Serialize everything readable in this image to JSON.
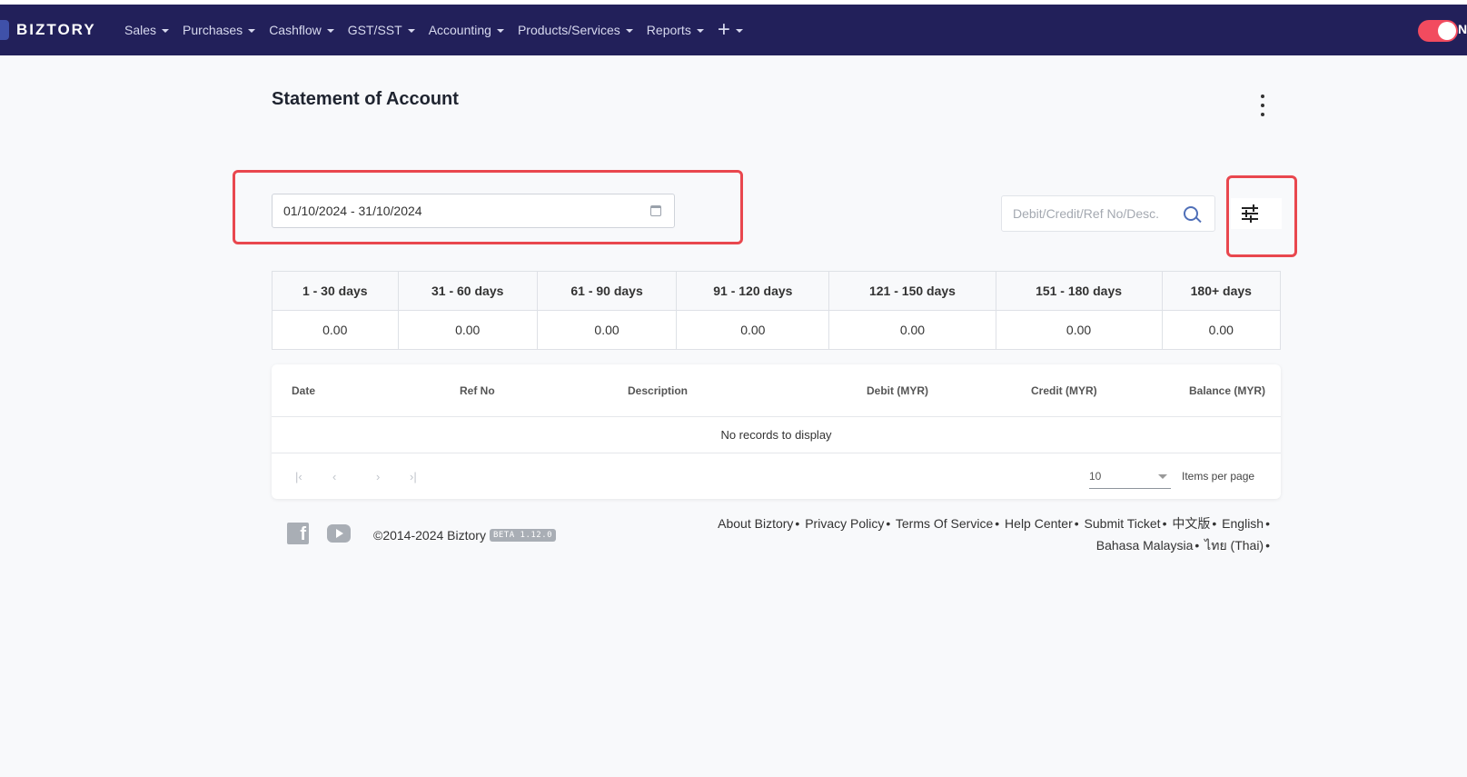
{
  "navbar": {
    "brand": "BIZTORY",
    "menu": [
      {
        "label": "Sales"
      },
      {
        "label": "Purchases"
      },
      {
        "label": "Cashflow"
      },
      {
        "label": "GST/SST"
      },
      {
        "label": "Accounting"
      },
      {
        "label": "Products/Services"
      },
      {
        "label": "Reports"
      }
    ],
    "plus_symbol": "+",
    "toggle_text": "N",
    "toggle_on": true,
    "toggle_color": "#f24b5f",
    "background": "#22205a"
  },
  "page": {
    "title": "Statement of Account"
  },
  "filters": {
    "date_range": "01/10/2024 - 31/10/2024",
    "search_placeholder": "Debit/Credit/Ref No/Desc."
  },
  "aging": {
    "headers": [
      "1 - 30 days",
      "31 - 60 days",
      "61 - 90 days",
      "91 - 120 days",
      "121 - 150 days",
      "151 - 180 days",
      "180+ days"
    ],
    "values": [
      "0.00",
      "0.00",
      "0.00",
      "0.00",
      "0.00",
      "0.00",
      "0.00"
    ]
  },
  "records": {
    "columns": [
      "Date",
      "Ref No",
      "Description",
      "Debit (MYR)",
      "Credit (MYR)",
      "Balance (MYR)"
    ],
    "empty_text": "No records to display",
    "per_page_value": "10",
    "per_page_label": "Items per page"
  },
  "footer": {
    "copyright": "©2014-2024 Biztory",
    "version_badge": "BETA 1.12.0",
    "links": [
      "About Biztory",
      "Privacy Policy",
      "Terms Of Service",
      "Help Center",
      "Submit Ticket",
      "中文版",
      "English",
      "Bahasa Malaysia",
      "ไทย (Thai)"
    ],
    "separator": "•"
  },
  "colors": {
    "highlight": "#e9474e",
    "accent": "#4f6fb8"
  }
}
